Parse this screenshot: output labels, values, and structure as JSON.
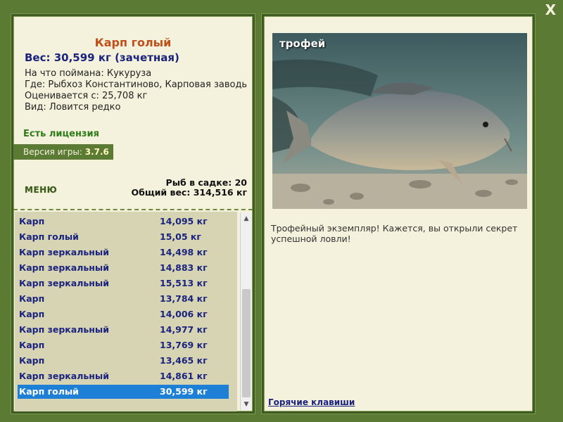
{
  "window": {
    "close_label": "X"
  },
  "fish": {
    "name": "Карп голый",
    "weight": "Вес: 30,599 кг (зачетная)",
    "caught_on": "На что поймана: Кукуруза",
    "where": "Где: Рыбхоз Константиново, Карповая заводь",
    "valued_from": "Оценивается с: 25,708 кг",
    "kind": "Вид: Ловится редко"
  },
  "license": "Есть лицензия",
  "version": {
    "label": "Версия игры: ",
    "value": "3.7.6"
  },
  "menu_label": "МЕНЮ",
  "stats": {
    "fish_in_keepnet": "Рыб в садке: 20",
    "total_weight": "Общий вес: 314,516 кг"
  },
  "catch_list": [
    {
      "name": "Карп",
      "weight": "14,095 кг"
    },
    {
      "name": "Карп голый",
      "weight": "15,05 кг"
    },
    {
      "name": "Карп зеркальный",
      "weight": "14,498 кг"
    },
    {
      "name": "Карп зеркальный",
      "weight": "14,883 кг"
    },
    {
      "name": "Карп зеркальный",
      "weight": "15,513 кг"
    },
    {
      "name": "Карп",
      "weight": "13,784 кг"
    },
    {
      "name": "Карп",
      "weight": "14,006 кг"
    },
    {
      "name": "Карп зеркальный",
      "weight": "14,977 кг"
    },
    {
      "name": "Карп",
      "weight": "13,769 кг"
    },
    {
      "name": "Карп",
      "weight": "13,465 кг"
    },
    {
      "name": "Карп зеркальный",
      "weight": "14,861 кг"
    },
    {
      "name": "Карп голый",
      "weight": "30,599 кг"
    }
  ],
  "selected_index": 11,
  "photo": {
    "label": "трофей"
  },
  "description": "Трофейный экземпляр! Кажется, вы открыли секрет успешной ловли!",
  "hotkeys_label": "Горячие клавиши",
  "colors": {
    "background": "#5b7a34",
    "panel": "#f4f1dc",
    "selected": "#1e7fd6",
    "link": "#1a237e"
  }
}
